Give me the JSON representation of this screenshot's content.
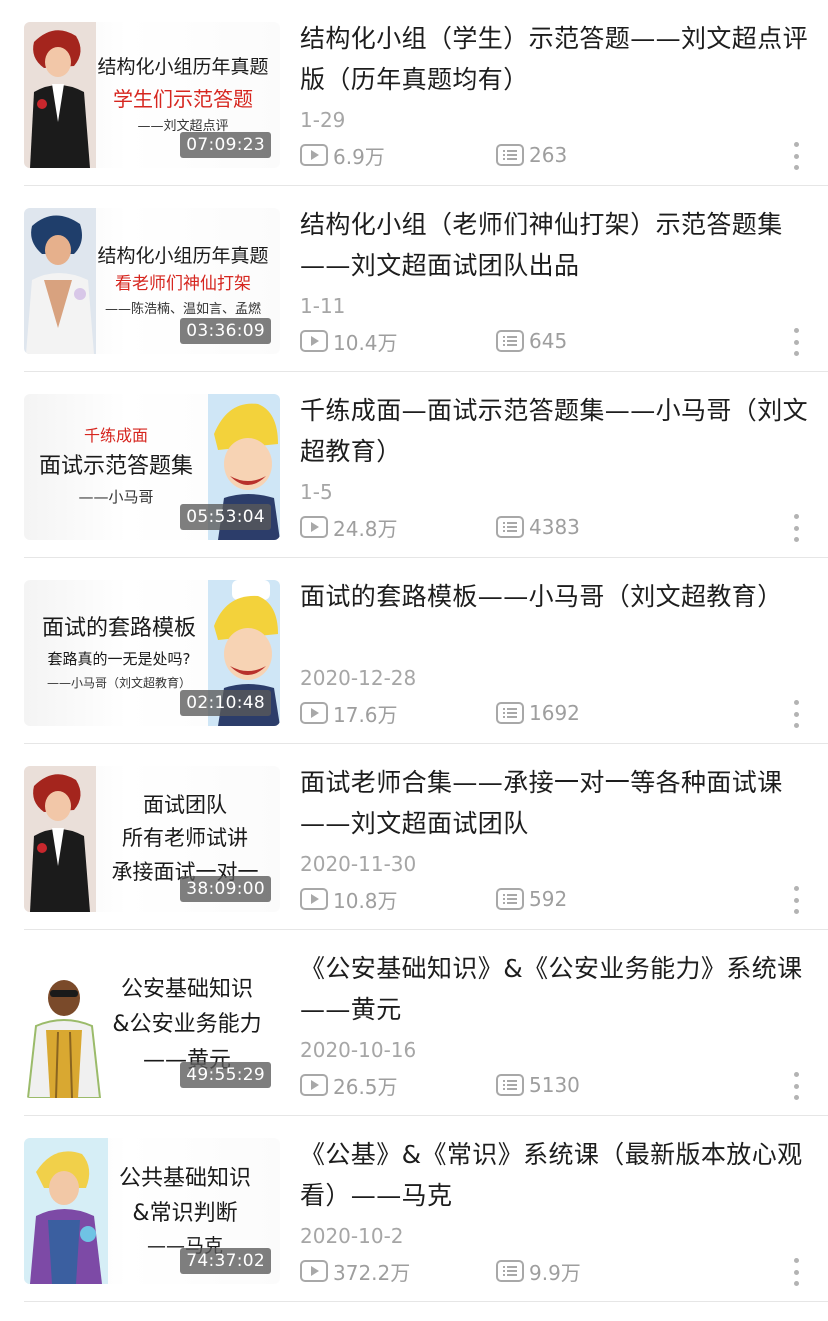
{
  "items": [
    {
      "thumb": {
        "line1": "结构化小组历年真题",
        "line2": "学生们示范答题",
        "line3": "——刘文超点评",
        "duration": "07:09:23"
      },
      "title": "结构化小组（学生）示范答题——刘文超点评版（历年真题均有）",
      "date": "1-29",
      "views": "6.9万",
      "comments": "263"
    },
    {
      "thumb": {
        "line1": "结构化小组历年真题",
        "line2": "看老师们神仙打架",
        "line3": "——陈浩楠、温如言、孟燃",
        "duration": "03:36:09"
      },
      "title": "结构化小组（老师们神仙打架）示范答题集——刘文超面试团队出品",
      "date": "1-11",
      "views": "10.4万",
      "comments": "645"
    },
    {
      "thumb": {
        "line1": "千练成面",
        "line2": "面试示范答题集",
        "line3": "——小马哥",
        "duration": "05:53:04"
      },
      "title": "千练成面—面试示范答题集——小马哥（刘文超教育）",
      "date": "1-5",
      "views": "24.8万",
      "comments": "4383"
    },
    {
      "thumb": {
        "line1": "面试的套路模板",
        "line2": "套路真的一无是处吗?",
        "line3": "——小马哥（刘文超教育）",
        "duration": "02:10:48"
      },
      "title": "面试的套路模板——小马哥（刘文超教育）",
      "date": "2020-12-28",
      "views": "17.6万",
      "comments": "1692"
    },
    {
      "thumb": {
        "line1": "面试团队",
        "line2": "所有老师试讲",
        "line3": "承接面试一对一",
        "duration": "38:09:00"
      },
      "title": "面试老师合集——承接一对一等各种面试课——刘文超面试团队",
      "date": "2020-11-30",
      "views": "10.8万",
      "comments": "592"
    },
    {
      "thumb": {
        "line1": "公安基础知识",
        "line2": "&公安业务能力",
        "line3": "——黄元",
        "duration": "49:55:29"
      },
      "title": "《公安基础知识》&《公安业务能力》系统课——黄元",
      "date": "2020-10-16",
      "views": "26.5万",
      "comments": "5130"
    },
    {
      "thumb": {
        "line1": "公共基础知识",
        "line2": "&常识判断",
        "line3": "——马克",
        "duration": "74:37:02"
      },
      "title": "《公基》&《常识》系统课（最新版本放心观看）——马克",
      "date": "2020-10-2",
      "views": "372.2万",
      "comments": "9.9万"
    }
  ],
  "icons": {
    "views": "play-count-icon",
    "comments": "danmaku-list-icon",
    "more": "more-vertical-icon"
  },
  "colors": {
    "accent_red": "#d6261f",
    "meta_gray": "#9e9e9e",
    "duration_bg": "#5a5a5a"
  }
}
